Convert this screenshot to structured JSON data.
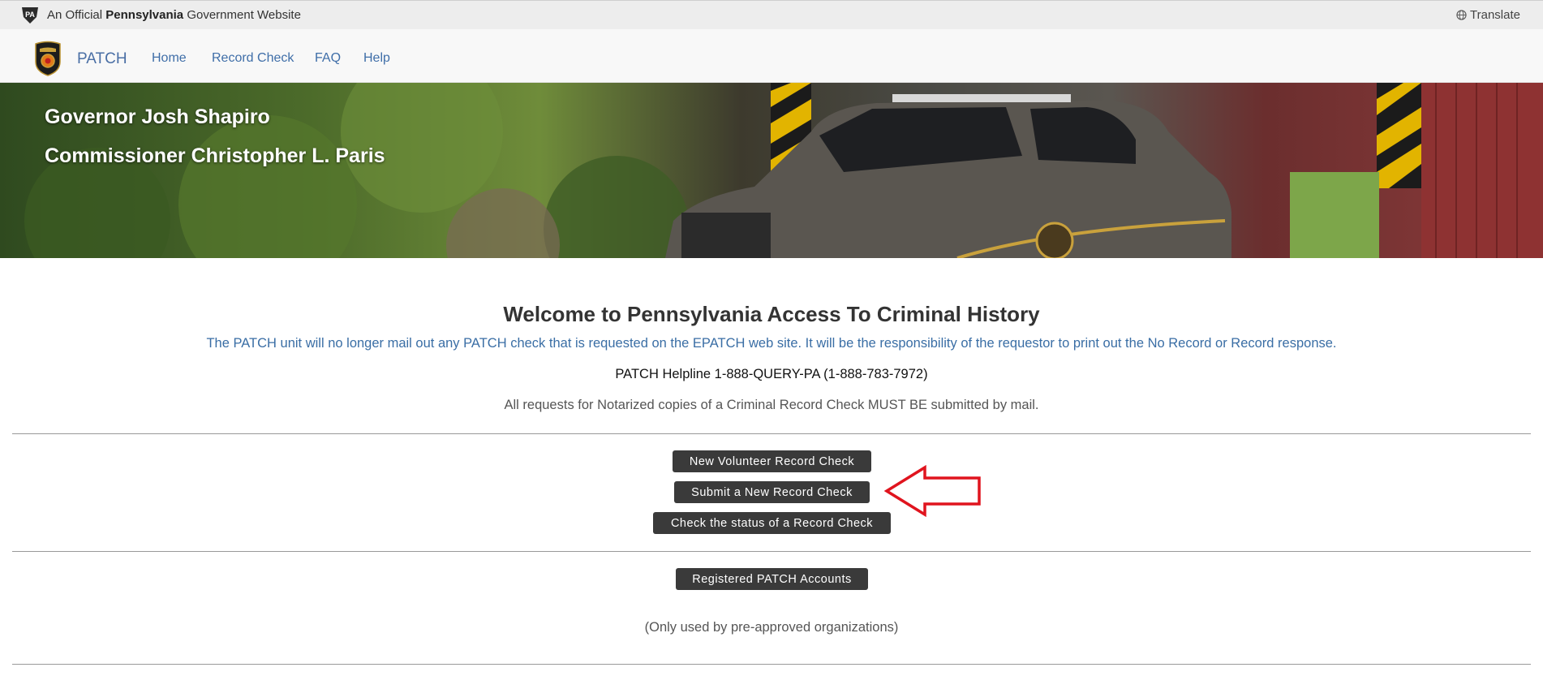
{
  "topbar": {
    "official_prefix": "An Official ",
    "official_state": "Pennsylvania",
    "official_suffix": " Government Website",
    "translate_label": "Translate"
  },
  "nav": {
    "brand": "PATCH",
    "items": [
      "Home",
      "Record Check",
      "FAQ",
      "Help"
    ]
  },
  "hero": {
    "governor": "Governor Josh Shapiro",
    "commissioner": "Commissioner Christopher L. Paris"
  },
  "main": {
    "welcome_title": "Welcome to Pennsylvania Access To Criminal History",
    "notice": "The PATCH unit will no longer mail out any PATCH check that is requested on the EPATCH web site. It will be the responsibility of the requestor to print out the No Record or Record response.",
    "helpline": "PATCH Helpline 1-888-QUERY-PA (1-888-783-7972)",
    "notarized": "All requests for Notarized copies of a Criminal Record Check MUST BE submitted by mail.",
    "buttons": {
      "volunteer": "New Volunteer Record Check",
      "submit": "Submit a New Record Check",
      "status": "Check the status of a Record Check",
      "registered": "Registered PATCH Accounts"
    },
    "only_used": "(Only used by pre-approved organizations)"
  },
  "colors": {
    "link": "#3f6ea8",
    "button_bg": "#3a3a3a",
    "arrow": "#e0141e"
  }
}
